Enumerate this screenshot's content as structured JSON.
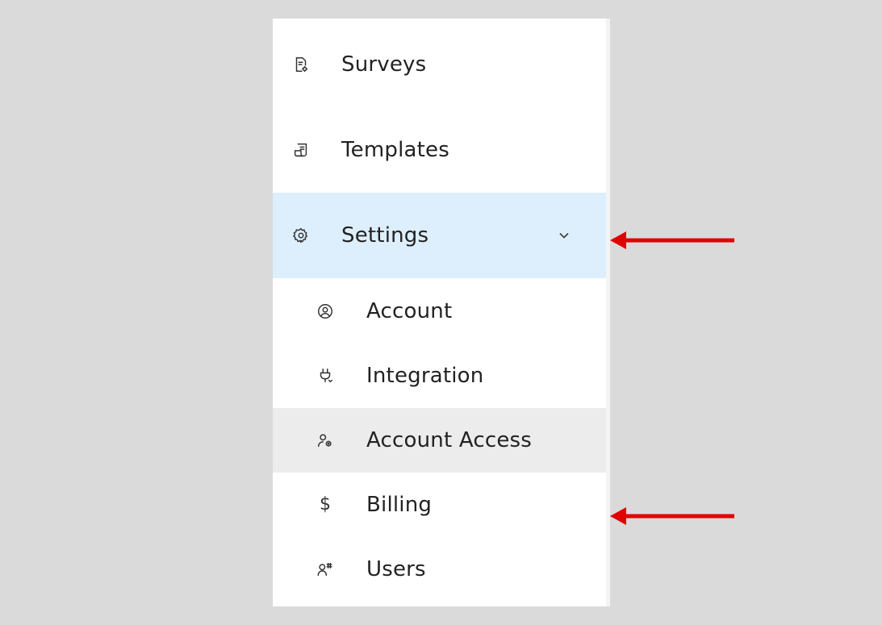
{
  "nav": {
    "items": [
      {
        "label": "Surveys",
        "icon": "survey-document-icon"
      },
      {
        "label": "Templates",
        "icon": "template-document-icon"
      },
      {
        "label": "Settings",
        "icon": "gear-icon",
        "expanded": true,
        "state": "active"
      }
    ],
    "settings_children": [
      {
        "label": "Account",
        "icon": "account-circle-icon"
      },
      {
        "label": "Integration",
        "icon": "plug-icon"
      },
      {
        "label": "Account Access",
        "icon": "user-gear-icon",
        "state": "hovered"
      },
      {
        "label": "Billing",
        "icon": "dollar-icon"
      },
      {
        "label": "Users",
        "icon": "users-icon"
      }
    ],
    "dollar_glyph": "$"
  },
  "annotations": {
    "arrow_color": "#e00000",
    "arrows": [
      "pointing-to-settings",
      "pointing-to-billing"
    ]
  },
  "colors": {
    "background": "#dadada",
    "panel": "#ffffff",
    "active_bg": "#ddeefd",
    "hover_bg": "#ececec"
  }
}
